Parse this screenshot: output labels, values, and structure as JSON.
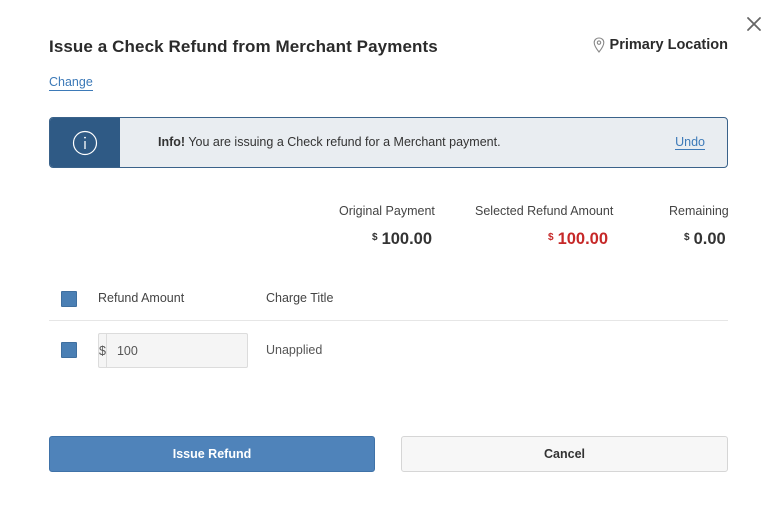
{
  "dialog": {
    "title": "Issue a Check Refund from Merchant Payments",
    "location": "Primary Location",
    "change_link": "Change"
  },
  "info_banner": {
    "lead": "Info!",
    "message": " You are issuing a Check refund for a Merchant payment.",
    "undo": "Undo"
  },
  "summary": {
    "original_payment": {
      "label": "Original Payment",
      "currency": "$",
      "value": "100.00"
    },
    "selected_refund": {
      "label": "Selected Refund Amount",
      "currency": "$",
      "value": "100.00",
      "color": "#c62828"
    },
    "remaining": {
      "label": "Remaining",
      "currency": "$",
      "value": "0.00"
    }
  },
  "table": {
    "headers": {
      "refund_amount": "Refund Amount",
      "charge_title": "Charge Title"
    },
    "rows": [
      {
        "currency": "$",
        "amount": "100",
        "charge_title": "Unapplied",
        "checked": true
      }
    ]
  },
  "buttons": {
    "issue_refund": "Issue Refund",
    "cancel": "Cancel"
  },
  "colors": {
    "accent": "#4f83ba",
    "banner_icon_bg": "#2f5a85",
    "link": "#3d7ab8",
    "negative": "#c62828"
  },
  "icons": {
    "close": "close-icon",
    "location": "location-pin-icon",
    "info": "info-icon"
  }
}
